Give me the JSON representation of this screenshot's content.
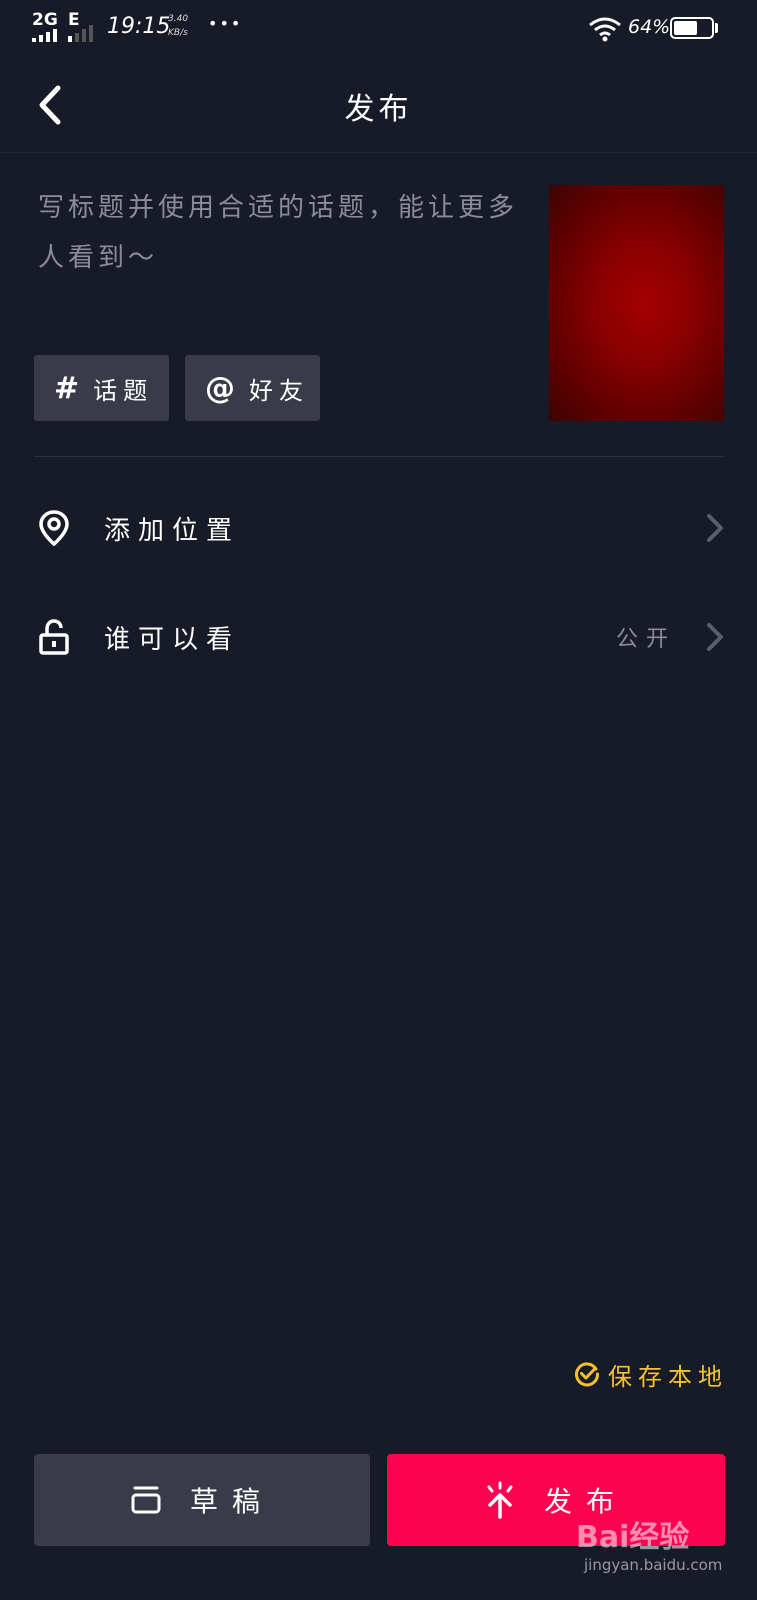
{
  "status_bar": {
    "network_1": "2G",
    "network_2": "E",
    "time": "19:15",
    "speed_value": "3.40",
    "speed_unit": "KB/s",
    "more": "•••",
    "battery_percent": "64%",
    "battery_level": 0.64
  },
  "header": {
    "back_icon": "chevron-left-icon",
    "title": "发布"
  },
  "caption": {
    "placeholder": "写标题并使用合适的话题，能让更多人看到～"
  },
  "chips": [
    {
      "icon": "#",
      "label": "话题"
    },
    {
      "icon": "@",
      "label": "好友"
    }
  ],
  "rows": {
    "location": {
      "icon": "location-pin-icon",
      "label": "添加位置"
    },
    "visibility": {
      "icon": "unlock-icon",
      "label": "谁可以看",
      "value": "公开"
    }
  },
  "save_local": {
    "label": "保存本地",
    "checked": true,
    "color": "#f6c02f"
  },
  "buttons": {
    "draft": {
      "label": "草稿",
      "icon": "draft-box-icon"
    },
    "publish": {
      "label": "发布",
      "icon": "publish-upload-icon",
      "color": "#fe0252"
    }
  },
  "watermark": {
    "brand": "Bai经验",
    "url": "jingyan.baidu.com"
  }
}
